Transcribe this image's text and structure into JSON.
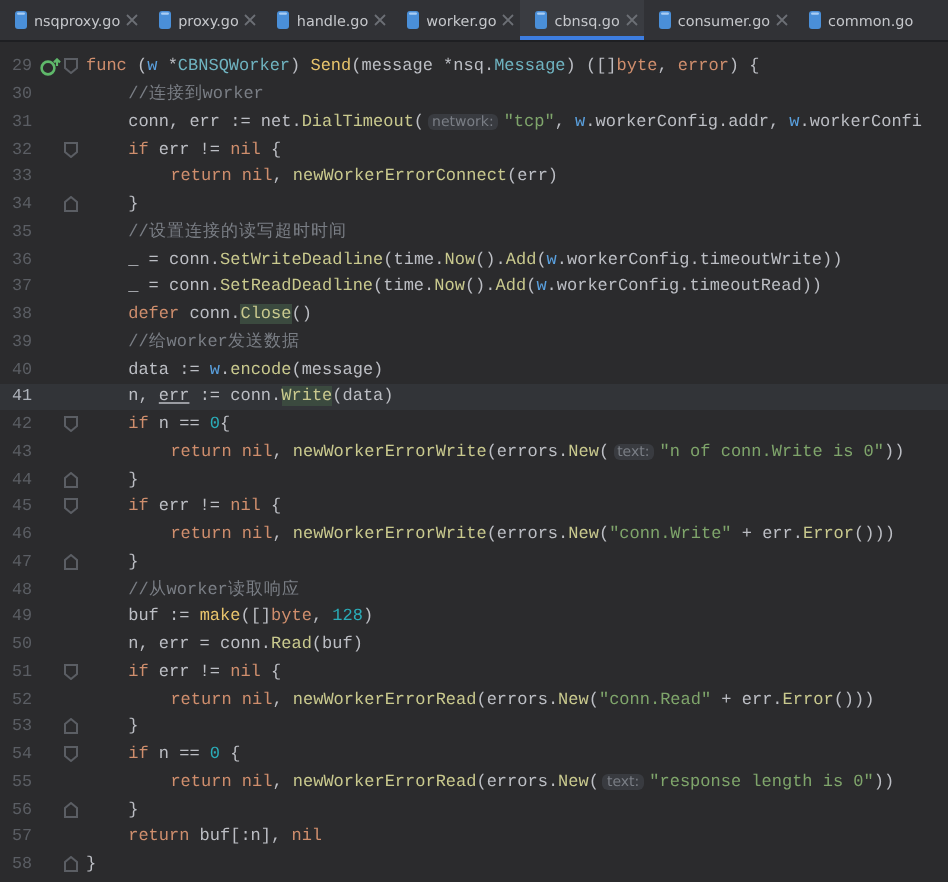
{
  "tabs": [
    {
      "label": "nsqproxy.go",
      "selected": false,
      "closable": true
    },
    {
      "label": "proxy.go",
      "selected": false,
      "closable": true
    },
    {
      "label": "handle.go",
      "selected": false,
      "closable": true
    },
    {
      "label": "worker.go",
      "selected": false,
      "closable": true
    },
    {
      "label": "cbnsq.go",
      "selected": true,
      "closable": true
    },
    {
      "label": "consumer.go",
      "selected": false,
      "closable": true
    },
    {
      "label": "common.go",
      "selected": false,
      "closable": false
    }
  ],
  "editor": {
    "lines": [
      {
        "number": "29",
        "current": false,
        "fold_end": false,
        "implements": true,
        "tokens": [
          {
            "kind": "kw",
            "text": "func"
          },
          {
            "kind": "p",
            "text": " ("
          },
          {
            "kind": "recv",
            "text": "w"
          },
          {
            "kind": "p",
            "text": " *"
          },
          {
            "kind": "type",
            "text": "CBNSQWorker"
          },
          {
            "kind": "p",
            "text": ") "
          },
          {
            "kind": "fn",
            "text": "Send"
          },
          {
            "kind": "p",
            "text": "(message *nsq."
          },
          {
            "kind": "type",
            "text": "Message"
          },
          {
            "kind": "p",
            "text": ") ([]"
          },
          {
            "kind": "kw",
            "text": "byte"
          },
          {
            "kind": "p",
            "text": ","
          },
          {
            "kind": "kw",
            "text": " error"
          },
          {
            "kind": "p",
            "text": ") {"
          }
        ],
        "children": [
          {
            "number": "30",
            "current": false,
            "fold_end": false,
            "implements": false,
            "tokens": [
              {
                "kind": "cm",
                "text": "//连接到worker"
              }
            ]
          },
          {
            "number": "31",
            "current": false,
            "fold_end": false,
            "implements": false,
            "tokens": [
              {
                "kind": "p",
                "text": "conn, err := net."
              },
              {
                "kind": "call",
                "text": "DialTimeout"
              },
              {
                "kind": "p",
                "text": "("
              },
              {
                "kind": "hint",
                "text": "network:"
              },
              {
                "kind": "str",
                "text": "\"tcp\""
              },
              {
                "kind": "p",
                "text": ","
              },
              {
                "kind": "recv",
                "text": " w"
              },
              {
                "kind": "p",
                "text": ".workerConfig.addr,"
              },
              {
                "kind": "recv",
                "text": " w"
              },
              {
                "kind": "p",
                "text": ".workerConfi"
              }
            ]
          },
          {
            "number": "32",
            "current": false,
            "fold_end": false,
            "implements": false,
            "tokens": [
              {
                "kind": "kw",
                "text": "if"
              },
              {
                "kind": "p",
                "text": " err != "
              },
              {
                "kind": "kw",
                "text": "nil"
              },
              {
                "kind": "p",
                "text": " {"
              }
            ],
            "children": [
              {
                "number": "33",
                "current": false,
                "fold_end": false,
                "implements": false,
                "tokens": [
                  {
                    "kind": "kw",
                    "text": "return"
                  },
                  {
                    "kind": "kw",
                    "text": " nil"
                  },
                  {
                    "kind": "p",
                    "text": ", "
                  },
                  {
                    "kind": "call",
                    "text": "newWorkerErrorConnect"
                  },
                  {
                    "kind": "p",
                    "text": "(err)"
                  }
                ]
              }
            ]
          },
          {
            "number": "34",
            "current": false,
            "fold_end": true,
            "implements": false,
            "tokens": [
              {
                "kind": "p",
                "text": "}"
              }
            ]
          },
          {
            "number": "35",
            "current": false,
            "fold_end": false,
            "implements": false,
            "tokens": [
              {
                "kind": "cm",
                "text": "//设置连接的读写超时时间"
              }
            ]
          },
          {
            "number": "36",
            "current": false,
            "fold_end": false,
            "implements": false,
            "tokens": [
              {
                "kind": "p",
                "text": "_ = conn."
              },
              {
                "kind": "call",
                "text": "SetWriteDeadline"
              },
              {
                "kind": "p",
                "text": "(time."
              },
              {
                "kind": "call",
                "text": "Now"
              },
              {
                "kind": "p",
                "text": "()."
              },
              {
                "kind": "call",
                "text": "Add"
              },
              {
                "kind": "p",
                "text": "("
              },
              {
                "kind": "recv",
                "text": "w"
              },
              {
                "kind": "p",
                "text": ".workerConfig.timeoutWrite))"
              }
            ]
          },
          {
            "number": "37",
            "current": false,
            "fold_end": false,
            "implements": false,
            "tokens": [
              {
                "kind": "p",
                "text": "_ = conn."
              },
              {
                "kind": "call",
                "text": "SetReadDeadline"
              },
              {
                "kind": "p",
                "text": "(time."
              },
              {
                "kind": "call",
                "text": "Now"
              },
              {
                "kind": "p",
                "text": "()."
              },
              {
                "kind": "call",
                "text": "Add"
              },
              {
                "kind": "p",
                "text": "("
              },
              {
                "kind": "recv",
                "text": "w"
              },
              {
                "kind": "p",
                "text": ".workerConfig.timeoutRead))"
              }
            ]
          },
          {
            "number": "38",
            "current": false,
            "fold_end": false,
            "implements": false,
            "tokens": [
              {
                "kind": "kw",
                "text": "defer"
              },
              {
                "kind": "p",
                "text": " conn."
              },
              {
                "kind": "hl",
                "text": "Close"
              },
              {
                "kind": "p",
                "text": "()"
              }
            ]
          },
          {
            "number": "39",
            "current": false,
            "fold_end": false,
            "implements": false,
            "tokens": [
              {
                "kind": "cm",
                "text": "//给worker发送数据"
              }
            ]
          },
          {
            "number": "40",
            "current": false,
            "fold_end": false,
            "implements": false,
            "tokens": [
              {
                "kind": "p",
                "text": "data := "
              },
              {
                "kind": "recv",
                "text": "w"
              },
              {
                "kind": "p",
                "text": "."
              },
              {
                "kind": "call",
                "text": "encode"
              },
              {
                "kind": "p",
                "text": "(message)"
              }
            ]
          },
          {
            "number": "41",
            "current": true,
            "fold_end": false,
            "implements": false,
            "tokens": [
              {
                "kind": "p",
                "text": "n, "
              },
              {
                "kind": "ul",
                "text": "err"
              },
              {
                "kind": "p",
                "text": " := conn."
              },
              {
                "kind": "hl",
                "text": "Write"
              },
              {
                "kind": "p",
                "text": "(data)"
              }
            ]
          },
          {
            "number": "42",
            "current": false,
            "fold_end": false,
            "implements": false,
            "tokens": [
              {
                "kind": "kw",
                "text": "if"
              },
              {
                "kind": "p",
                "text": " n == "
              },
              {
                "kind": "num",
                "text": "0"
              },
              {
                "kind": "p",
                "text": "{"
              }
            ],
            "children": [
              {
                "number": "43",
                "current": false,
                "fold_end": false,
                "implements": false,
                "tokens": [
                  {
                    "kind": "kw",
                    "text": "return"
                  },
                  {
                    "kind": "kw",
                    "text": " nil"
                  },
                  {
                    "kind": "p",
                    "text": ", "
                  },
                  {
                    "kind": "call",
                    "text": "newWorkerErrorWrite"
                  },
                  {
                    "kind": "p",
                    "text": "(errors."
                  },
                  {
                    "kind": "call",
                    "text": "New"
                  },
                  {
                    "kind": "p",
                    "text": "("
                  },
                  {
                    "kind": "hint",
                    "text": "text:"
                  },
                  {
                    "kind": "str",
                    "text": "\"n of conn.Write is 0\""
                  },
                  {
                    "kind": "p",
                    "text": "))"
                  }
                ]
              }
            ]
          },
          {
            "number": "44",
            "current": false,
            "fold_end": true,
            "implements": false,
            "tokens": [
              {
                "kind": "p",
                "text": "}"
              }
            ]
          },
          {
            "number": "45",
            "current": false,
            "fold_end": false,
            "implements": false,
            "tokens": [
              {
                "kind": "kw",
                "text": "if"
              },
              {
                "kind": "p",
                "text": " err != "
              },
              {
                "kind": "kw",
                "text": "nil"
              },
              {
                "kind": "p",
                "text": " {"
              }
            ],
            "children": [
              {
                "number": "46",
                "current": false,
                "fold_end": false,
                "implements": false,
                "tokens": [
                  {
                    "kind": "kw",
                    "text": "return"
                  },
                  {
                    "kind": "kw",
                    "text": " nil"
                  },
                  {
                    "kind": "p",
                    "text": ", "
                  },
                  {
                    "kind": "call",
                    "text": "newWorkerErrorWrite"
                  },
                  {
                    "kind": "p",
                    "text": "(errors."
                  },
                  {
                    "kind": "call",
                    "text": "New"
                  },
                  {
                    "kind": "p",
                    "text": "("
                  },
                  {
                    "kind": "str",
                    "text": "\"conn.Write\""
                  },
                  {
                    "kind": "p",
                    "text": " + err."
                  },
                  {
                    "kind": "call",
                    "text": "Error"
                  },
                  {
                    "kind": "p",
                    "text": "()))"
                  }
                ]
              }
            ]
          },
          {
            "number": "47",
            "current": false,
            "fold_end": true,
            "implements": false,
            "tokens": [
              {
                "kind": "p",
                "text": "}"
              }
            ]
          },
          {
            "number": "48",
            "current": false,
            "fold_end": false,
            "implements": false,
            "tokens": [
              {
                "kind": "cm",
                "text": "//从worker读取响应"
              }
            ]
          },
          {
            "number": "49",
            "current": false,
            "fold_end": false,
            "implements": false,
            "tokens": [
              {
                "kind": "p",
                "text": "buf := "
              },
              {
                "kind": "fn",
                "text": "make"
              },
              {
                "kind": "p",
                "text": "([]"
              },
              {
                "kind": "kw",
                "text": "byte"
              },
              {
                "kind": "p",
                "text": ", "
              },
              {
                "kind": "num",
                "text": "128"
              },
              {
                "kind": "p",
                "text": ")"
              }
            ]
          },
          {
            "number": "50",
            "current": false,
            "fold_end": false,
            "implements": false,
            "tokens": [
              {
                "kind": "p",
                "text": "n, err = conn."
              },
              {
                "kind": "call",
                "text": "Read"
              },
              {
                "kind": "p",
                "text": "(buf)"
              }
            ]
          },
          {
            "number": "51",
            "current": false,
            "fold_end": false,
            "implements": false,
            "tokens": [
              {
                "kind": "kw",
                "text": "if"
              },
              {
                "kind": "p",
                "text": " err != "
              },
              {
                "kind": "kw",
                "text": "nil"
              },
              {
                "kind": "p",
                "text": " {"
              }
            ],
            "children": [
              {
                "number": "52",
                "current": false,
                "fold_end": false,
                "implements": false,
                "tokens": [
                  {
                    "kind": "kw",
                    "text": "return"
                  },
                  {
                    "kind": "kw",
                    "text": " nil"
                  },
                  {
                    "kind": "p",
                    "text": ", "
                  },
                  {
                    "kind": "call",
                    "text": "newWorkerErrorRead"
                  },
                  {
                    "kind": "p",
                    "text": "(errors."
                  },
                  {
                    "kind": "call",
                    "text": "New"
                  },
                  {
                    "kind": "p",
                    "text": "("
                  },
                  {
                    "kind": "str",
                    "text": "\"conn.Read\""
                  },
                  {
                    "kind": "p",
                    "text": " + err."
                  },
                  {
                    "kind": "call",
                    "text": "Error"
                  },
                  {
                    "kind": "p",
                    "text": "()))"
                  }
                ]
              }
            ]
          },
          {
            "number": "53",
            "current": false,
            "fold_end": true,
            "implements": false,
            "tokens": [
              {
                "kind": "p",
                "text": "}"
              }
            ]
          },
          {
            "number": "54",
            "current": false,
            "fold_end": false,
            "implements": false,
            "tokens": [
              {
                "kind": "kw",
                "text": "if"
              },
              {
                "kind": "p",
                "text": " n == "
              },
              {
                "kind": "num",
                "text": "0"
              },
              {
                "kind": "p",
                "text": " {"
              }
            ],
            "children": [
              {
                "number": "55",
                "current": false,
                "fold_end": false,
                "implements": false,
                "tokens": [
                  {
                    "kind": "kw",
                    "text": "return"
                  },
                  {
                    "kind": "kw",
                    "text": " nil"
                  },
                  {
                    "kind": "p",
                    "text": ", "
                  },
                  {
                    "kind": "call",
                    "text": "newWorkerErrorRead"
                  },
                  {
                    "kind": "p",
                    "text": "(errors."
                  },
                  {
                    "kind": "call",
                    "text": "New"
                  },
                  {
                    "kind": "p",
                    "text": "("
                  },
                  {
                    "kind": "hint",
                    "text": "text:"
                  },
                  {
                    "kind": "str",
                    "text": "\"response length is 0\""
                  },
                  {
                    "kind": "p",
                    "text": "))"
                  }
                ]
              }
            ]
          },
          {
            "number": "56",
            "current": false,
            "fold_end": true,
            "implements": false,
            "tokens": [
              {
                "kind": "p",
                "text": "}"
              }
            ]
          },
          {
            "number": "57",
            "current": false,
            "fold_end": false,
            "implements": false,
            "tokens": [
              {
                "kind": "kw",
                "text": "return"
              },
              {
                "kind": "p",
                "text": " buf[:n],"
              },
              {
                "kind": "kw",
                "text": " nil"
              }
            ]
          }
        ]
      },
      {
        "number": "58",
        "current": false,
        "fold_end": true,
        "implements": false,
        "tokens": [
          {
            "kind": "p",
            "text": "}"
          }
        ]
      }
    ]
  }
}
